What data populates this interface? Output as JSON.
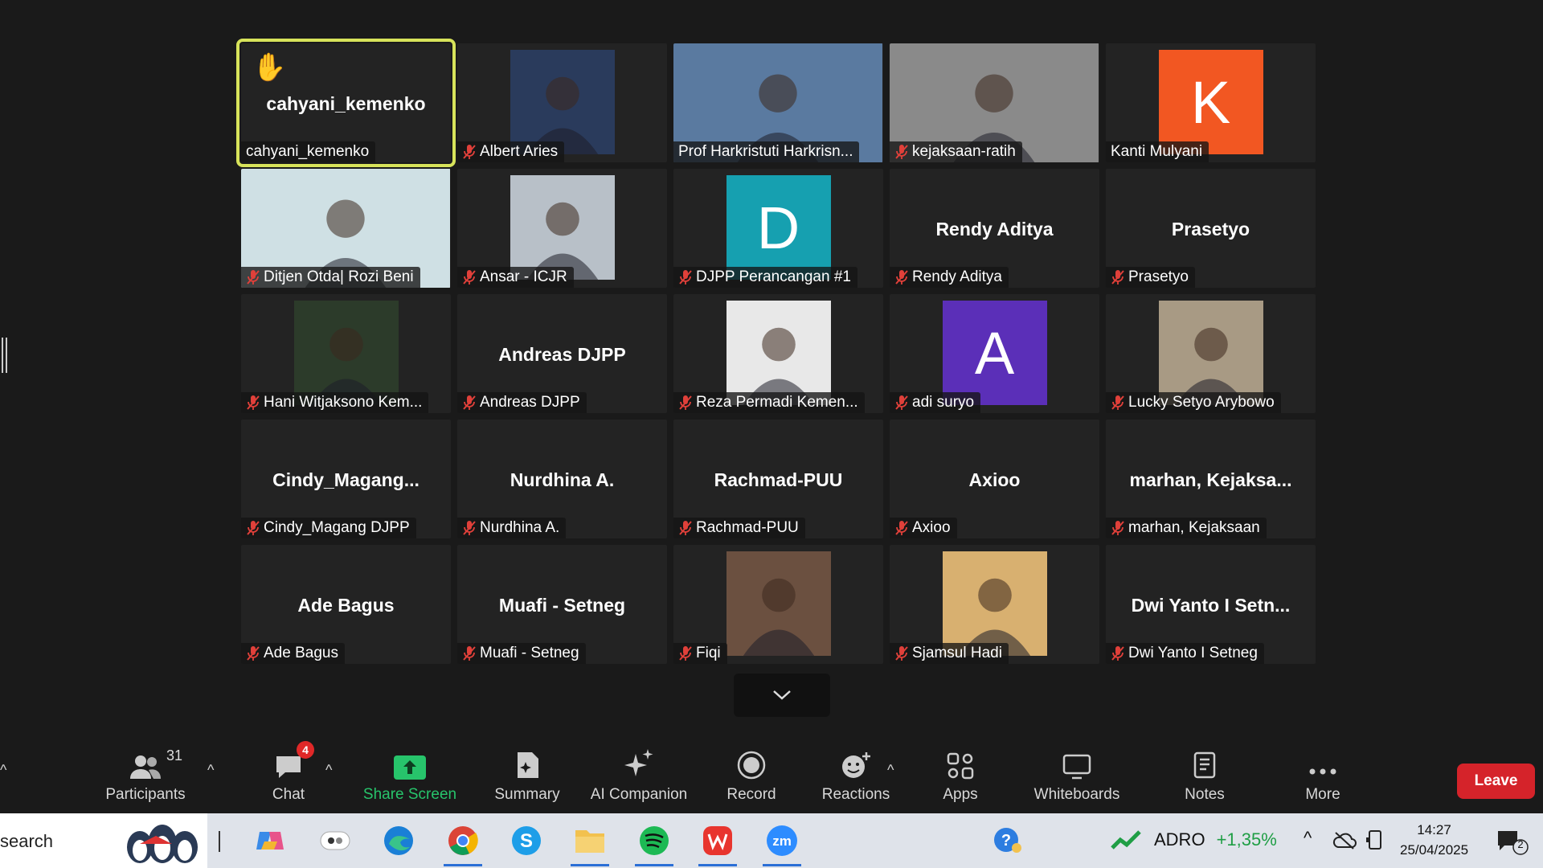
{
  "meeting": {
    "tiles": [
      {
        "big": "cahyani_kemenko",
        "label": "cahyani_kemenko",
        "muted": false,
        "hand": true,
        "type": "name"
      },
      {
        "label": "Albert Aries",
        "muted": true,
        "type": "video",
        "bg": "#2a3b5c"
      },
      {
        "label": "Prof Harkristuti Harkrisn...",
        "muted": false,
        "type": "videowide",
        "bg": "#5a7aa0"
      },
      {
        "label": "kejaksaan-ratih",
        "muted": true,
        "type": "videowide",
        "bg": "#8a8a8a"
      },
      {
        "label": "Kanti Mulyani",
        "muted": false,
        "type": "avatar",
        "letter": "K",
        "bg": "#f25722"
      },
      {
        "label": "Ditjen Otda| Rozi Beni",
        "muted": true,
        "type": "videowide",
        "bg": "#cfe0e4"
      },
      {
        "label": "Ansar - ICJR",
        "muted": true,
        "type": "video",
        "bg": "#b8c0c8"
      },
      {
        "label": "DJPP Perancangan #1",
        "muted": true,
        "type": "avatar",
        "letter": "D",
        "bg": "#16a0b0"
      },
      {
        "big": "Rendy Aditya",
        "label": "Rendy Aditya",
        "muted": true,
        "type": "name"
      },
      {
        "big": "Prasetyo",
        "label": "Prasetyo",
        "muted": true,
        "type": "name"
      },
      {
        "label": "Hani Witjaksono Kem...",
        "muted": true,
        "type": "video",
        "bg": "#2c3b2a"
      },
      {
        "big": "Andreas DJPP",
        "label": "Andreas DJPP",
        "muted": true,
        "type": "name"
      },
      {
        "label": "Reza Permadi Kemen...",
        "muted": true,
        "type": "video",
        "bg": "#e8e8e8"
      },
      {
        "label": "adi suryo",
        "muted": true,
        "type": "avatar",
        "letter": "A",
        "bg": "#5b2fb8"
      },
      {
        "label": "Lucky Setyo Arybowo",
        "muted": true,
        "type": "video",
        "bg": "#a89a84"
      },
      {
        "big": "Cindy_Magang...",
        "label": "Cindy_Magang DJPP",
        "muted": true,
        "type": "name"
      },
      {
        "big": "Nurdhina A.",
        "label": "Nurdhina A.",
        "muted": true,
        "type": "name"
      },
      {
        "big": "Rachmad-PUU",
        "label": "Rachmad-PUU",
        "muted": true,
        "type": "name"
      },
      {
        "big": "Axioo",
        "label": "Axioo",
        "muted": true,
        "type": "name"
      },
      {
        "big": "marhan,  Kejaksa...",
        "label": "marhan, Kejaksaan",
        "muted": true,
        "type": "name"
      },
      {
        "big": "Ade Bagus",
        "label": "Ade Bagus",
        "muted": true,
        "type": "name"
      },
      {
        "big": "Muafi - Setneg",
        "label": "Muafi - Setneg",
        "muted": true,
        "type": "name"
      },
      {
        "label": "Fiqi",
        "muted": true,
        "type": "video",
        "bg": "#6b5040"
      },
      {
        "label": "Sjamsul Hadi",
        "muted": true,
        "type": "video",
        "bg": "#d8b070"
      },
      {
        "big": "Dwi Yanto I Setn...",
        "label": "Dwi Yanto I Setneg",
        "muted": true,
        "type": "name"
      }
    ]
  },
  "toolbar": {
    "participants_label": "Participants",
    "participants_count": "31",
    "chat_label": "Chat",
    "chat_badge": "4",
    "share_label": "Share Screen",
    "summary_label": "Summary",
    "ai_label": "AI Companion",
    "record_label": "Record",
    "reactions_label": "Reactions",
    "apps_label": "Apps",
    "whiteboards_label": "Whiteboards",
    "notes_label": "Notes",
    "more_label": "More",
    "leave_label": "Leave"
  },
  "taskbar": {
    "search_text": "search",
    "stock_symbol": "ADRO",
    "stock_change": "+1,35%",
    "time": "14:27",
    "date": "25/04/2025",
    "notif_count": "2"
  },
  "colors": {
    "active_border": "#d7e35a",
    "share_green": "#27c46b",
    "leave_red": "#d5232a",
    "mute_red": "#e0403a"
  }
}
